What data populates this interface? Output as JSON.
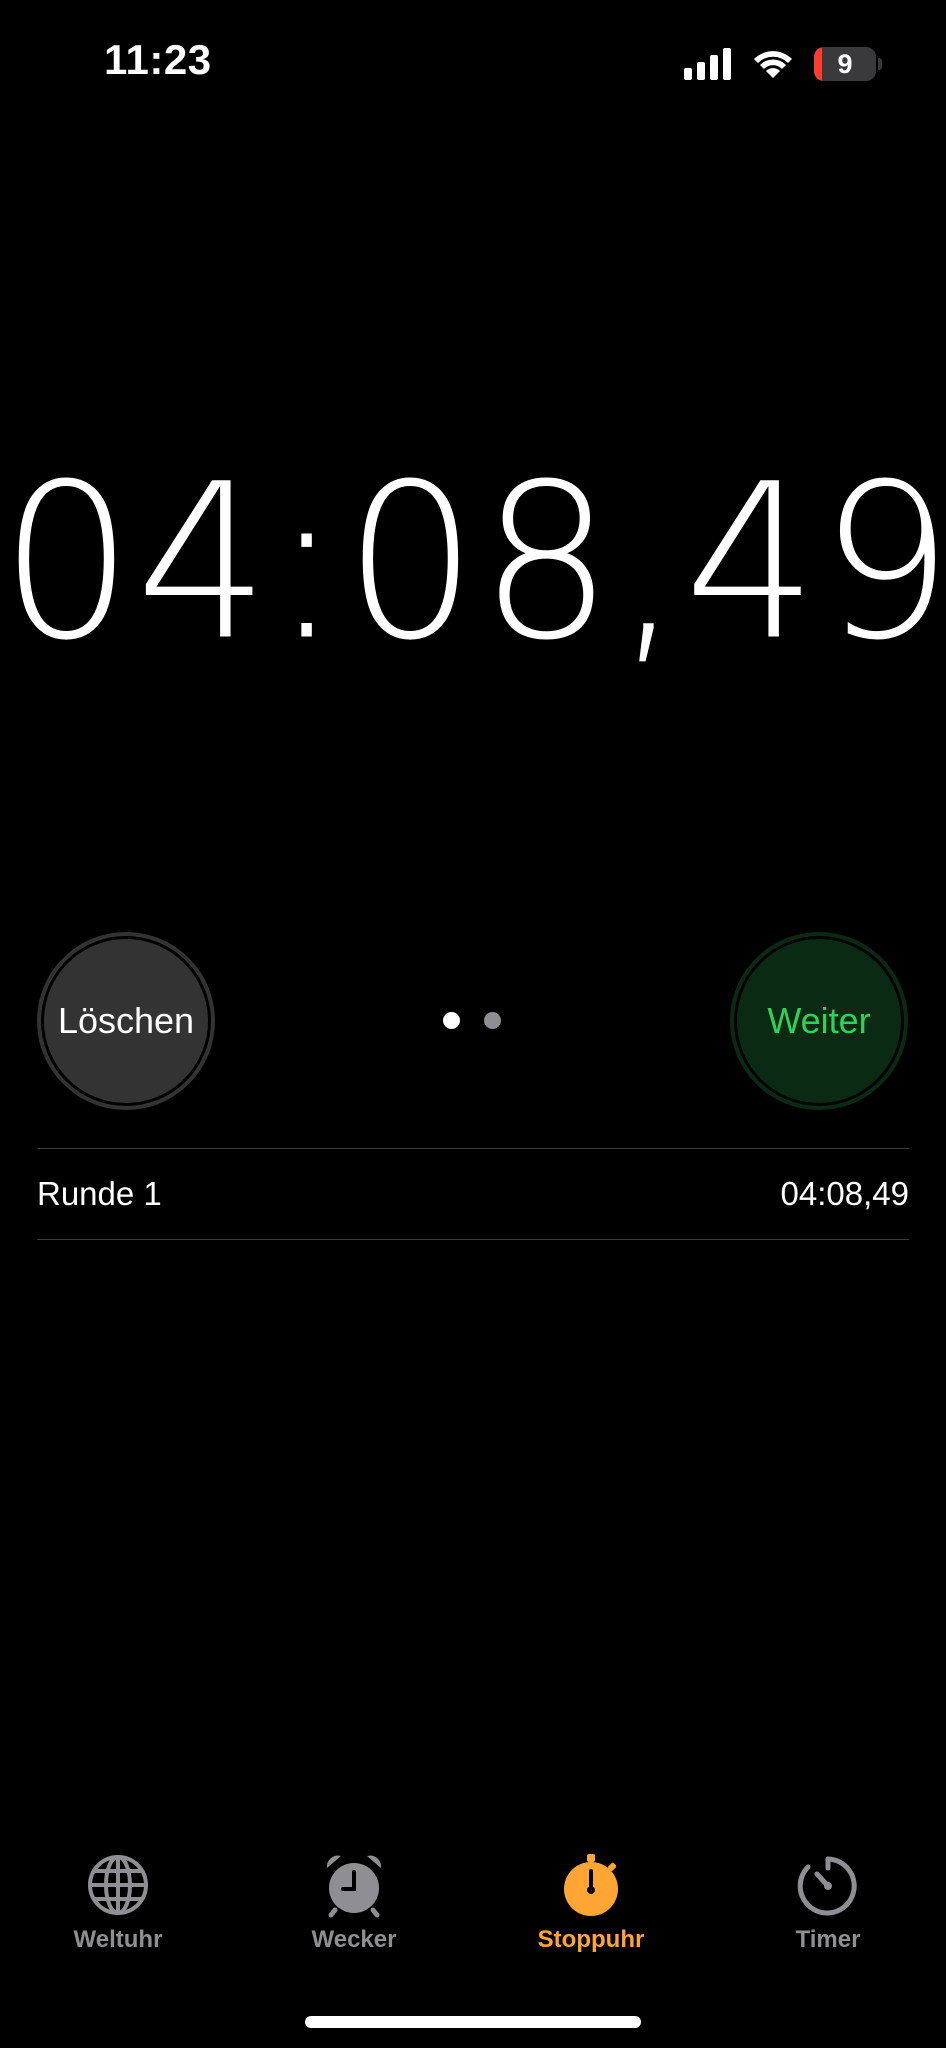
{
  "status_bar": {
    "time": "11:23",
    "battery_level": "9",
    "battery_color": "#ff3b30"
  },
  "stopwatch": {
    "display": "04:08,49"
  },
  "controls": {
    "clear_label": "Löschen",
    "resume_label": "Weiter",
    "page_count": 2,
    "active_page": 1
  },
  "laps": [
    {
      "label": "Runde 1",
      "time": "04:08,49"
    }
  ],
  "tab_bar": {
    "tabs": [
      {
        "label": "Weltuhr",
        "icon": "globe-icon",
        "active": false
      },
      {
        "label": "Wecker",
        "icon": "alarm-clock-icon",
        "active": false
      },
      {
        "label": "Stoppuhr",
        "icon": "stopwatch-icon",
        "active": true
      },
      {
        "label": "Timer",
        "icon": "timer-icon",
        "active": false
      }
    ],
    "active_color": "#ffa534",
    "inactive_color": "#8e8e93"
  },
  "colors": {
    "background": "#000000",
    "resume_text": "#30d158",
    "resume_bg": "#0a2a14",
    "clear_bg": "#333333"
  }
}
